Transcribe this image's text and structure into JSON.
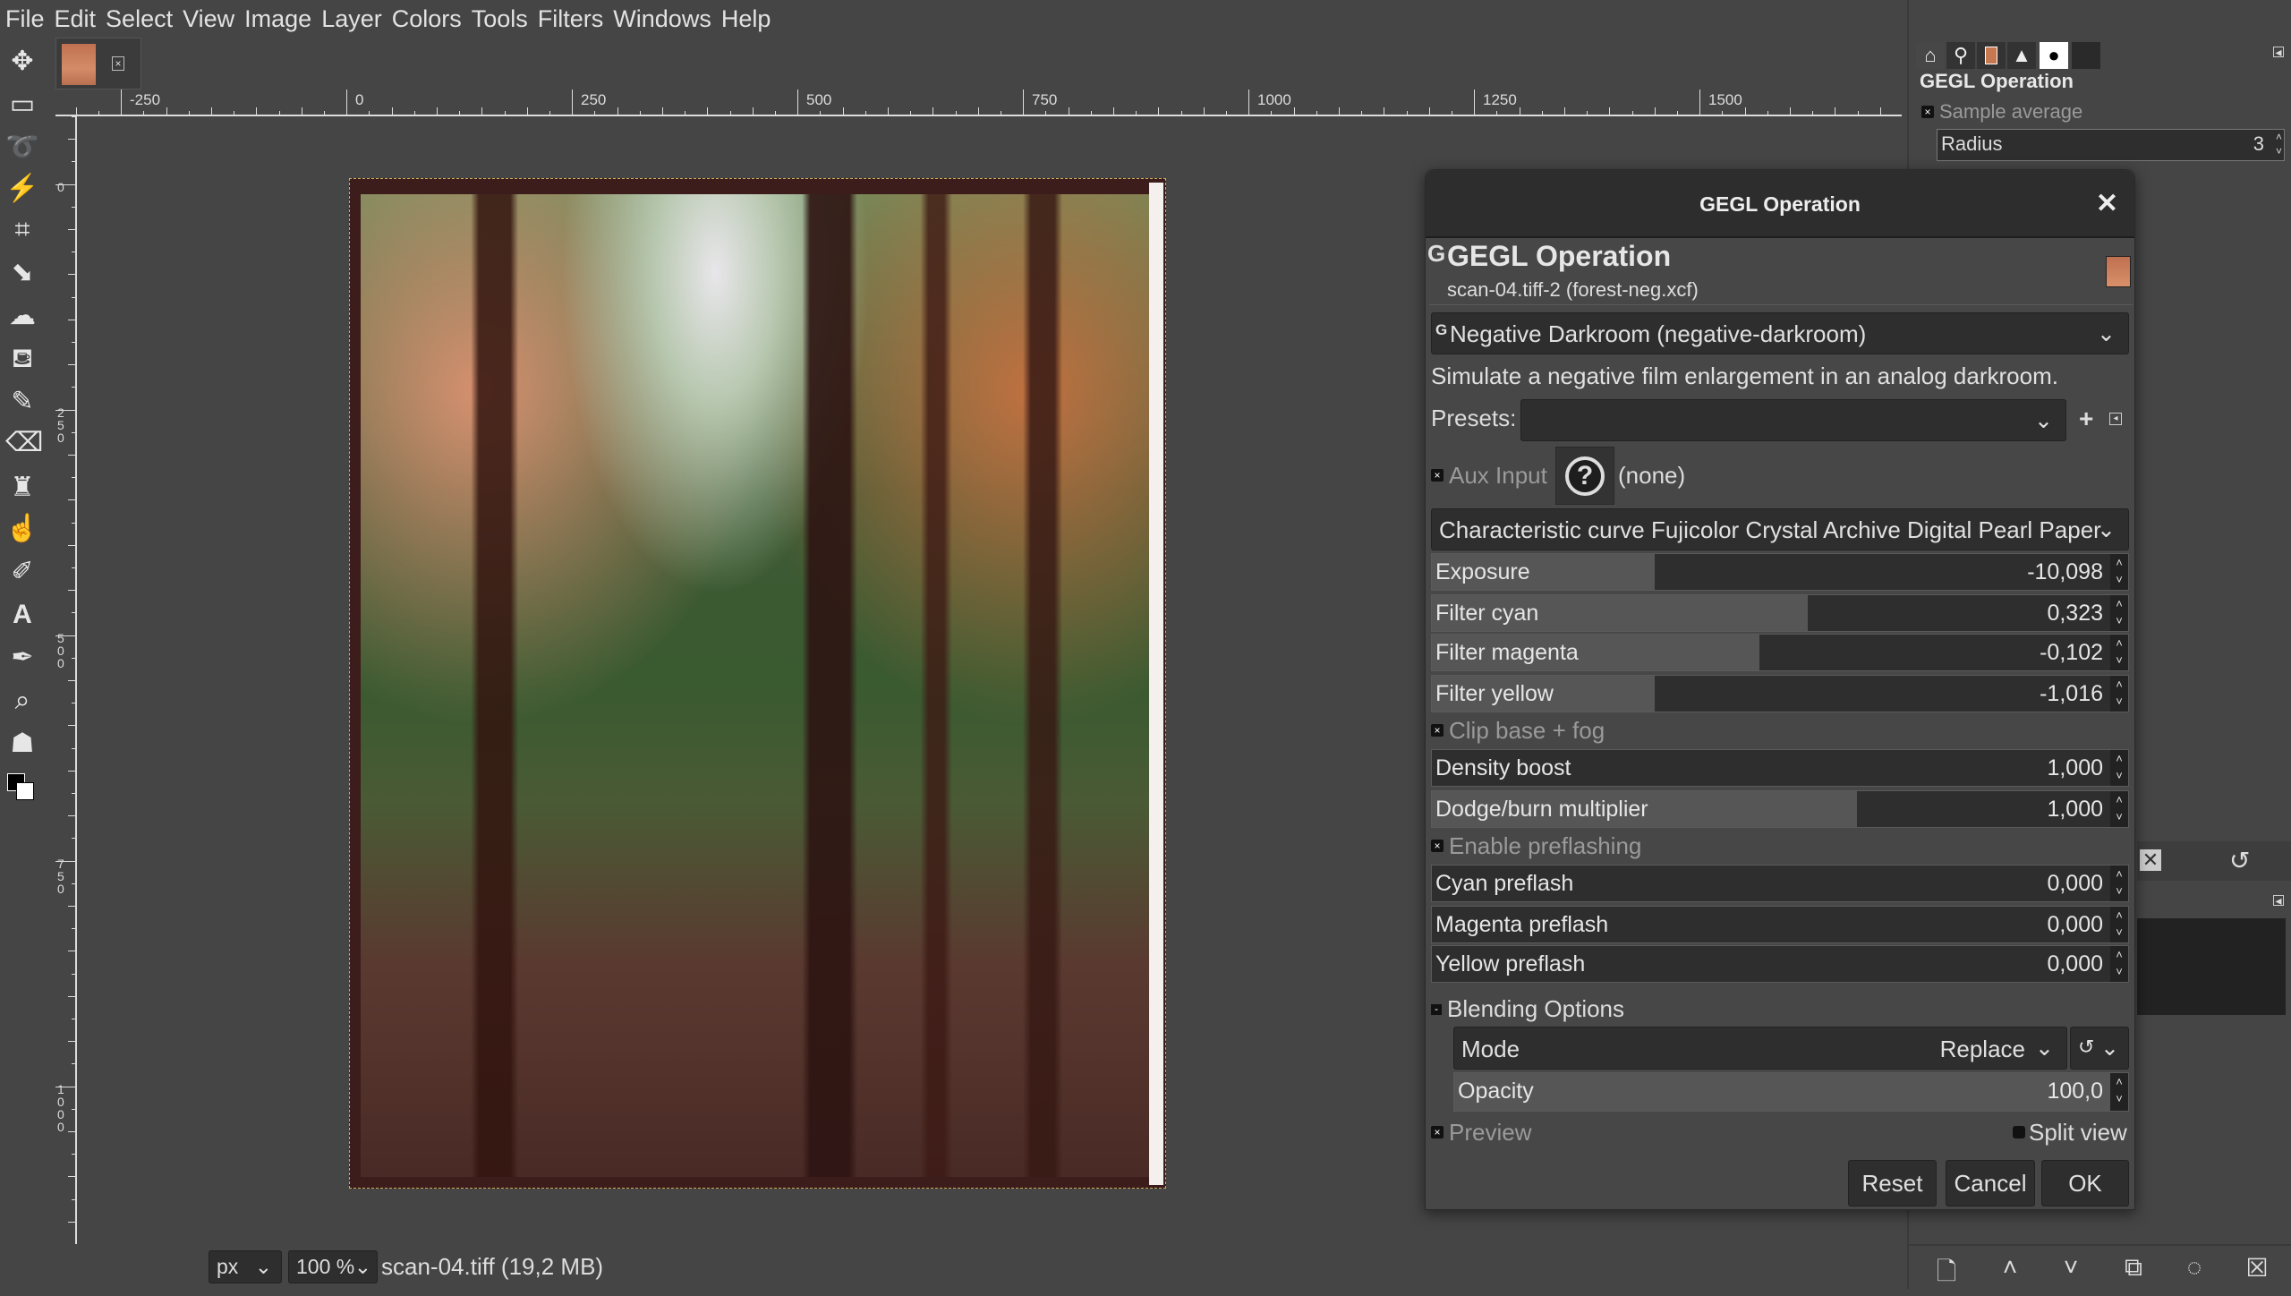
{
  "menu": [
    "File",
    "Edit",
    "Select",
    "View",
    "Image",
    "Layer",
    "Colors",
    "Tools",
    "Filters",
    "Windows",
    "Help"
  ],
  "toolbox": {
    "tools": [
      "move-tool",
      "rect-select-tool",
      "free-select-tool",
      "fuzzy-select-tool",
      "crop-tool",
      "unified-transform-tool",
      "warp-transform-tool",
      "bucket-fill-tool",
      "paintbrush-tool",
      "eraser-tool",
      "clone-tool",
      "smudge-tool",
      "paths-tool",
      "text-tool",
      "color-picker-tool",
      "zoom-tool",
      "gegl-tool",
      "fg-bg-colors"
    ]
  },
  "ruler": {
    "h_labels": [
      "-250",
      "0",
      "250",
      "500",
      "750",
      "1000",
      "1250",
      "1500"
    ],
    "v_labels": [
      "0",
      "250",
      "500",
      "750",
      "1000"
    ]
  },
  "status": {
    "unit": "px",
    "zoom": "100 %",
    "info": "scan-04.tiff (19,2 MB)"
  },
  "dock": {
    "title": "GEGL Operation",
    "sample_average": "Sample average",
    "radius_label": "Radius",
    "radius_value": "3"
  },
  "dialog": {
    "window_title": "GEGL Operation",
    "header_title": "GEGL Operation",
    "header_subtitle": "scan-04.tiff-2 (forest-neg.xcf)",
    "operation": "Negative Darkroom (negative-darkroom)",
    "description": "Simulate a negative film enlargement in an analog darkroom.",
    "presets_label": "Presets:",
    "presets_value": "",
    "aux_input_label": "Aux Input",
    "aux_input_value": "(none)",
    "curve": "Characteristic curve Fujicolor Crystal Archive Digital Pearl Paper",
    "sliders_a": [
      {
        "label": "Exposure",
        "value": "-10,098",
        "fill": 0.32
      },
      {
        "label": "Filter cyan",
        "value": "0,323",
        "fill": 0.54
      },
      {
        "label": "Filter magenta",
        "value": "-0,102",
        "fill": 0.47
      },
      {
        "label": "Filter yellow",
        "value": "-1,016",
        "fill": 0.32
      }
    ],
    "clip_label": "Clip base + fog",
    "sliders_b": [
      {
        "label": "Density boost",
        "value": "1,000",
        "fill": 0.0
      },
      {
        "label": "Dodge/burn multiplier",
        "value": "1,000",
        "fill": 0.61
      }
    ],
    "preflash_label": "Enable preflashing",
    "sliders_c": [
      {
        "label": "Cyan preflash",
        "value": "0,000",
        "fill": 0.0
      },
      {
        "label": "Magenta preflash",
        "value": "0,000",
        "fill": 0.0
      },
      {
        "label": "Yellow preflash",
        "value": "0,000",
        "fill": 0.0
      }
    ],
    "blending_label": "Blending Options",
    "mode_label": "Mode",
    "mode_value": "Replace",
    "opacity_label": "Opacity",
    "opacity_value": "100,0",
    "opacity_fill": 1.0,
    "preview_label": "Preview",
    "split_view_label": "Split view",
    "buttons": {
      "reset": "Reset",
      "cancel": "Cancel",
      "ok": "OK"
    }
  }
}
